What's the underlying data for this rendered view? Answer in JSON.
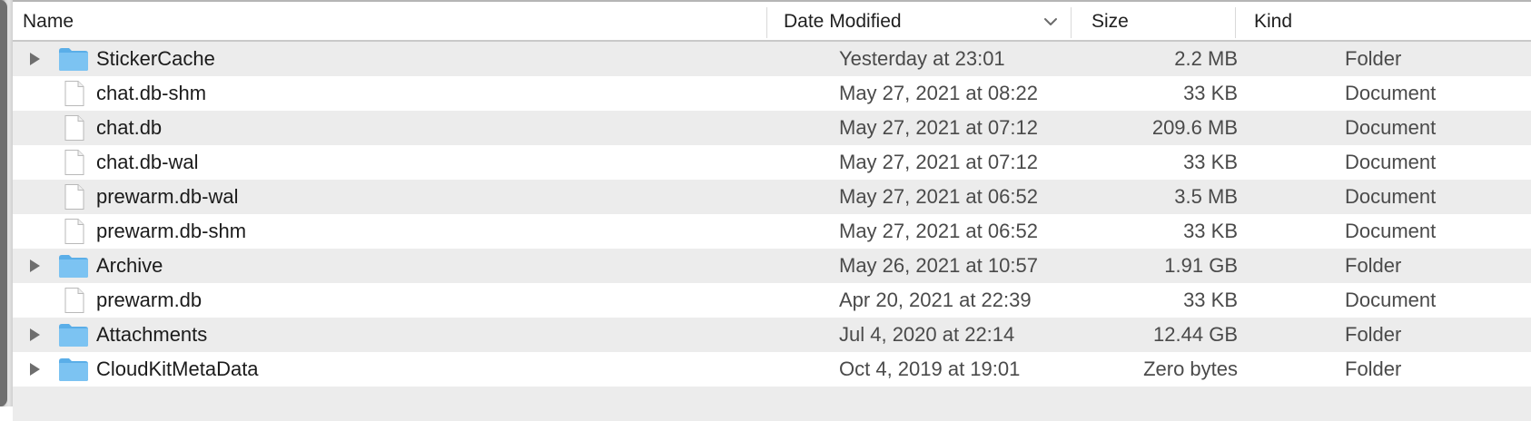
{
  "columns": {
    "name": "Name",
    "date_modified": "Date Modified",
    "size": "Size",
    "kind": "Kind"
  },
  "sort": {
    "column": "date_modified",
    "direction": "descending",
    "icon": "chevron-down-icon"
  },
  "rows": [
    {
      "name": "StickerCache",
      "date": "Yesterday at 23:01",
      "size": "2.2 MB",
      "kind": "Folder",
      "type": "folder"
    },
    {
      "name": "chat.db-shm",
      "date": "May 27, 2021 at 08:22",
      "size": "33 KB",
      "kind": "Document",
      "type": "document"
    },
    {
      "name": "chat.db",
      "date": "May 27, 2021 at 07:12",
      "size": "209.6 MB",
      "kind": "Document",
      "type": "document"
    },
    {
      "name": "chat.db-wal",
      "date": "May 27, 2021 at 07:12",
      "size": "33 KB",
      "kind": "Document",
      "type": "document"
    },
    {
      "name": "prewarm.db-wal",
      "date": "May 27, 2021 at 06:52",
      "size": "3.5 MB",
      "kind": "Document",
      "type": "document"
    },
    {
      "name": "prewarm.db-shm",
      "date": "May 27, 2021 at 06:52",
      "size": "33 KB",
      "kind": "Document",
      "type": "document"
    },
    {
      "name": "Archive",
      "date": "May 26, 2021 at 10:57",
      "size": "1.91 GB",
      "kind": "Folder",
      "type": "folder"
    },
    {
      "name": "prewarm.db",
      "date": "Apr 20, 2021 at 22:39",
      "size": "33 KB",
      "kind": "Document",
      "type": "document"
    },
    {
      "name": "Attachments",
      "date": "Jul 4, 2020 at 22:14",
      "size": "12.44 GB",
      "kind": "Folder",
      "type": "folder"
    },
    {
      "name": "CloudKitMetaData",
      "date": "Oct 4, 2019 at 19:01",
      "size": "Zero bytes",
      "kind": "Folder",
      "type": "folder"
    }
  ],
  "colors": {
    "folder": "#7cc3f2",
    "folder_tab": "#5aaee8",
    "row_alt": "#ececec",
    "header_border": "#c9c9c9"
  }
}
